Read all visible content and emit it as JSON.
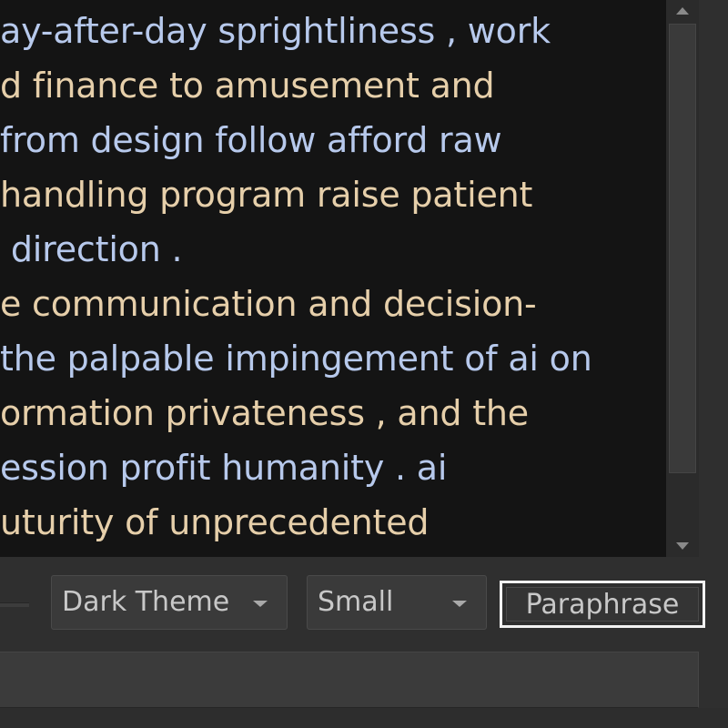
{
  "editor": {
    "lines": [
      "ay-after-day sprightliness , work",
      "d finance to amusement and",
      "from design follow afford raw",
      " handling program raise patient",
      "́ direction .",
      "e communication and decision-",
      "the palpable impingement of ai on",
      "ormation privateness , and the",
      "ession profit humanity . ai",
      "uturity of unprecedented"
    ]
  },
  "toolbar": {
    "theme_select": {
      "selected": "Dark Theme"
    },
    "size_select": {
      "selected": "Small"
    },
    "paraphrase_label": "Paraphrase"
  },
  "output": {
    "value": ""
  },
  "icons": {
    "scroll_up": "arrow-up-icon",
    "scroll_down": "arrow-down-icon",
    "dropdown": "chevron-down-icon"
  },
  "colors": {
    "background": "#141414",
    "text_primary": "#b7c9ec",
    "text_warm": "#e6cfaa",
    "focus_outline": "#f2f2f2"
  }
}
